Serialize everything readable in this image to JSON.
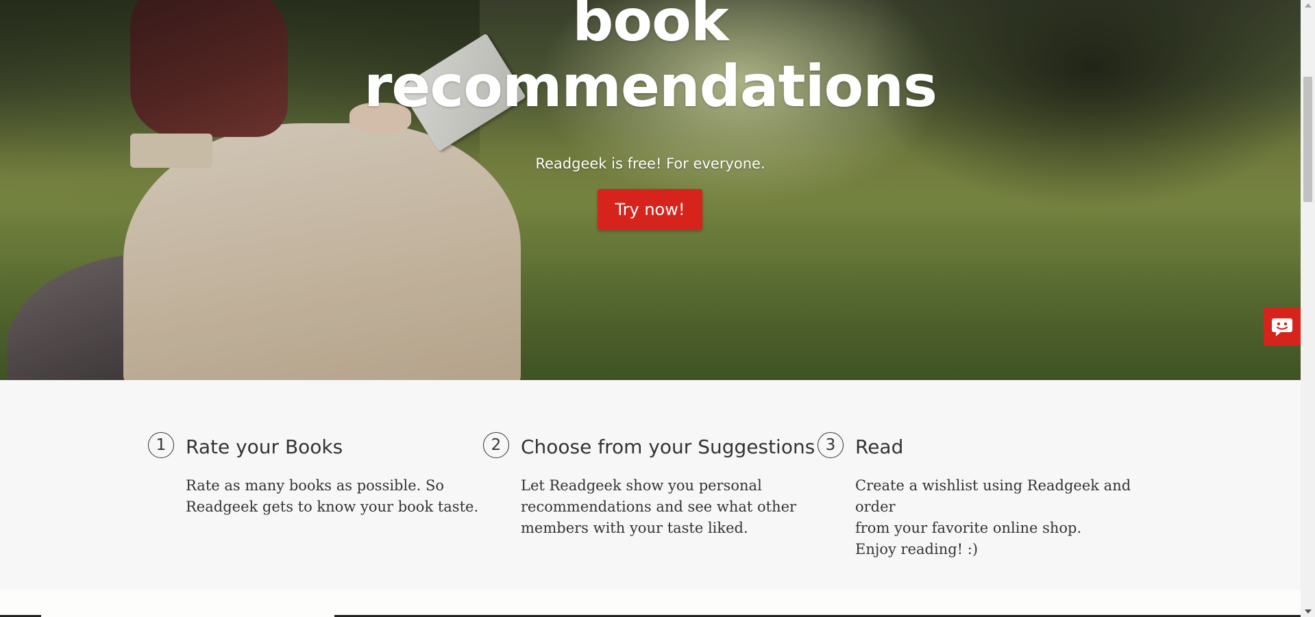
{
  "hero": {
    "title_line1": "book",
    "title_line2": "recommendations",
    "subtitle": "Readgeek is free! For everyone.",
    "cta_label": "Try now!"
  },
  "feedback": {
    "icon": "chat-face-icon"
  },
  "steps": [
    {
      "number": "1",
      "title": "Rate your Books",
      "lines": [
        "Rate as many books as possible. So",
        "Readgeek gets to know your book taste."
      ]
    },
    {
      "number": "2",
      "title": "Choose from your Suggestions",
      "lines": [
        "Let Readgeek show you personal",
        "recommendations and see what other",
        "members with your taste liked."
      ]
    },
    {
      "number": "3",
      "title": "Read",
      "lines": [
        "Create a wishlist using Readgeek and order",
        "from your favorite online shop.",
        "Enjoy reading! :)"
      ]
    }
  ],
  "colors": {
    "accent": "#d6241c",
    "text": "#333333",
    "section_bg": "#f7f7f7"
  }
}
